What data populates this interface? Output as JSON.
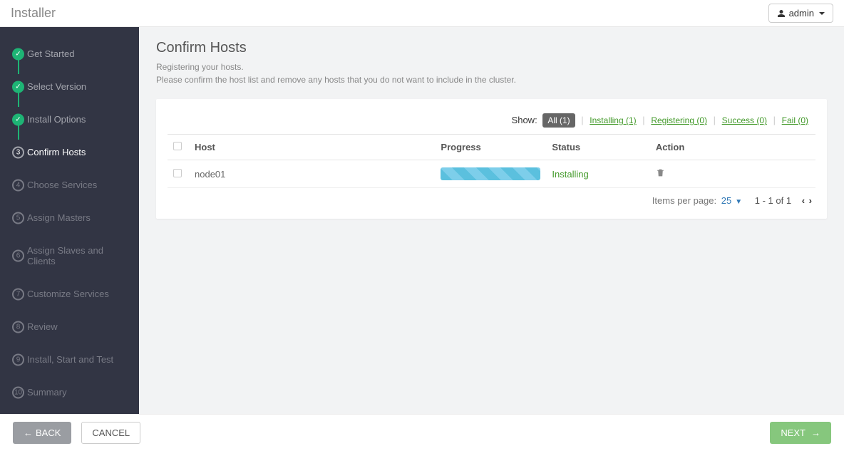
{
  "header": {
    "brand": "Installer",
    "user": "admin"
  },
  "sidebar": {
    "steps": [
      {
        "label": "Get Started",
        "state": "done"
      },
      {
        "label": "Select Version",
        "state": "done"
      },
      {
        "label": "Install Options",
        "state": "done"
      },
      {
        "label": "Confirm Hosts",
        "state": "active",
        "num": "3"
      },
      {
        "label": "Choose Services",
        "state": "pending",
        "num": "4"
      },
      {
        "label": "Assign Masters",
        "state": "pending",
        "num": "5"
      },
      {
        "label": "Assign Slaves and Clients",
        "state": "pending",
        "num": "6"
      },
      {
        "label": "Customize Services",
        "state": "pending",
        "num": "7"
      },
      {
        "label": "Review",
        "state": "pending",
        "num": "8"
      },
      {
        "label": "Install, Start and Test",
        "state": "pending",
        "num": "9"
      },
      {
        "label": "Summary",
        "state": "pending",
        "num": "10"
      }
    ]
  },
  "page": {
    "title": "Confirm Hosts",
    "subtitle1": "Registering your hosts.",
    "subtitle2": "Please confirm the host list and remove any hosts that you do not want to include in the cluster."
  },
  "filter": {
    "label": "Show:",
    "all": "All (1)",
    "installing": "Installing (1)",
    "registering": "Registering (0)",
    "success": "Success (0)",
    "fail": "Fail (0)"
  },
  "table": {
    "cols": {
      "host": "Host",
      "progress": "Progress",
      "status": "Status",
      "action": "Action"
    },
    "rows": [
      {
        "host": "node01",
        "status": "Installing"
      }
    ]
  },
  "pager": {
    "label": "Items per page:",
    "size": "25",
    "range": "1 - 1 of 1"
  },
  "footer": {
    "back": "BACK",
    "cancel": "CANCEL",
    "next": "NEXT"
  }
}
